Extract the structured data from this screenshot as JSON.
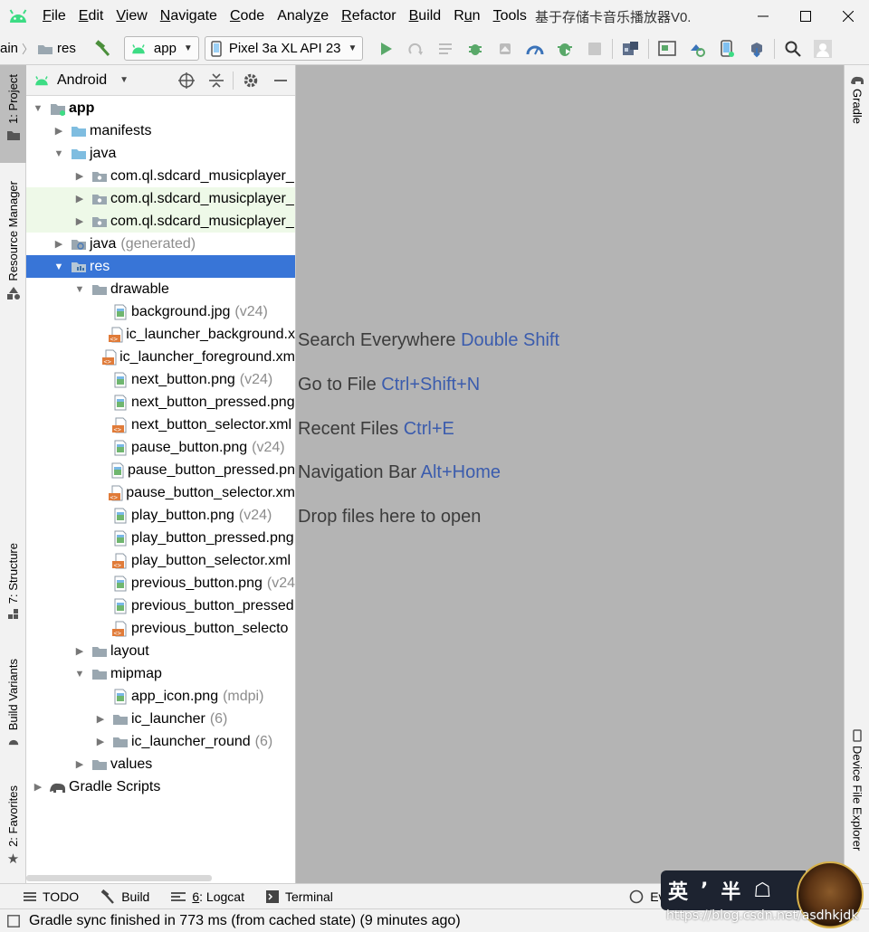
{
  "menubar": {
    "items": [
      {
        "pre": "",
        "u": "F",
        "post": "ile"
      },
      {
        "pre": "",
        "u": "E",
        "post": "dit"
      },
      {
        "pre": "",
        "u": "V",
        "post": "iew"
      },
      {
        "pre": "",
        "u": "N",
        "post": "avigate"
      },
      {
        "pre": "",
        "u": "C",
        "post": "ode"
      },
      {
        "pre": "Analy",
        "u": "z",
        "post": "e"
      },
      {
        "pre": "",
        "u": "R",
        "post": "efactor"
      },
      {
        "pre": "",
        "u": "B",
        "post": "uild"
      },
      {
        "pre": "R",
        "u": "u",
        "post": "n"
      },
      {
        "pre": "",
        "u": "T",
        "post": "ools"
      }
    ],
    "window_title": "基于存储卡音乐播放器V0.",
    "colors": {
      "android_green": "#3ddc84"
    }
  },
  "toolbar": {
    "crumb_prev": "ain",
    "crumb_current": "res",
    "run_config": "app",
    "device": "Pixel 3a XL API 23",
    "icons": [
      "hammer-icon",
      "run-icon",
      "apply-changes-icon",
      "sync-icon",
      "debug-icon",
      "attach-icon",
      "profile-icon",
      "coverage-icon",
      "stop-icon",
      "project-structure-icon",
      "avd-manager-icon",
      "sdk-manager-icon",
      "device-icon",
      "dependencies-icon",
      "search-icon",
      "user-icon"
    ]
  },
  "left_stripe": {
    "project_tab": "1: Project",
    "resource_tab": "Resource Manager",
    "structure_tab": "7: Structure",
    "build_variants_tab": "Build Variants",
    "favorites_tab": "2: Favorites"
  },
  "right_stripe": {
    "gradle_tab": "Gradle",
    "device_explorer_tab": "Device File Explorer"
  },
  "project_panel": {
    "view_mode": "Android",
    "tree": [
      {
        "depth": 0,
        "toggle": "open",
        "icon": "module",
        "label": "app",
        "bold": true
      },
      {
        "depth": 1,
        "toggle": "closed",
        "icon": "folder-blue",
        "label": "manifests"
      },
      {
        "depth": 1,
        "toggle": "open",
        "icon": "folder-blue",
        "label": "java"
      },
      {
        "depth": 2,
        "toggle": "closed",
        "icon": "package",
        "label": "com.ql.sdcard_musicplayer_"
      },
      {
        "depth": 2,
        "toggle": "closed",
        "icon": "package",
        "label": "com.ql.sdcard_musicplayer_",
        "hl": true
      },
      {
        "depth": 2,
        "toggle": "closed",
        "icon": "package",
        "label": "com.ql.sdcard_musicplayer_",
        "hl": true
      },
      {
        "depth": 1,
        "toggle": "closed",
        "icon": "folder-gen",
        "label": "java",
        "meta": "(generated)"
      },
      {
        "depth": 1,
        "toggle": "open",
        "icon": "folder-res",
        "label": "res",
        "selected": true
      },
      {
        "depth": 2,
        "toggle": "open",
        "icon": "folder-gray",
        "label": "drawable"
      },
      {
        "depth": 3,
        "toggle": "none",
        "icon": "image",
        "label": "background.jpg",
        "meta": "(v24)"
      },
      {
        "depth": 3,
        "toggle": "none",
        "icon": "xml",
        "label": "ic_launcher_background.x"
      },
      {
        "depth": 3,
        "toggle": "none",
        "icon": "xml",
        "label": "ic_launcher_foreground.xm"
      },
      {
        "depth": 3,
        "toggle": "none",
        "icon": "image",
        "label": "next_button.png",
        "meta": "(v24)"
      },
      {
        "depth": 3,
        "toggle": "none",
        "icon": "image",
        "label": "next_button_pressed.png"
      },
      {
        "depth": 3,
        "toggle": "none",
        "icon": "xml",
        "label": "next_button_selector.xml"
      },
      {
        "depth": 3,
        "toggle": "none",
        "icon": "image",
        "label": "pause_button.png",
        "meta": "(v24)"
      },
      {
        "depth": 3,
        "toggle": "none",
        "icon": "image",
        "label": "pause_button_pressed.pn"
      },
      {
        "depth": 3,
        "toggle": "none",
        "icon": "xml",
        "label": "pause_button_selector.xm"
      },
      {
        "depth": 3,
        "toggle": "none",
        "icon": "image",
        "label": "play_button.png",
        "meta": "(v24)"
      },
      {
        "depth": 3,
        "toggle": "none",
        "icon": "image",
        "label": "play_button_pressed.png"
      },
      {
        "depth": 3,
        "toggle": "none",
        "icon": "xml",
        "label": "play_button_selector.xml"
      },
      {
        "depth": 3,
        "toggle": "none",
        "icon": "image",
        "label": "previous_button.png",
        "meta": "(v24"
      },
      {
        "depth": 3,
        "toggle": "none",
        "icon": "image",
        "label": "previous_button_pressed"
      },
      {
        "depth": 3,
        "toggle": "none",
        "icon": "xml",
        "label": "previous_button_selecto"
      },
      {
        "depth": 2,
        "toggle": "closed",
        "icon": "folder-gray",
        "label": "layout"
      },
      {
        "depth": 2,
        "toggle": "open",
        "icon": "folder-gray",
        "label": "mipmap"
      },
      {
        "depth": 3,
        "toggle": "none",
        "icon": "image",
        "label": "app_icon.png",
        "meta": "(mdpi)"
      },
      {
        "depth": 3,
        "toggle": "closed",
        "icon": "folder-gray",
        "label": "ic_launcher",
        "meta": "(6)"
      },
      {
        "depth": 3,
        "toggle": "closed",
        "icon": "folder-gray",
        "label": "ic_launcher_round",
        "meta": "(6)"
      },
      {
        "depth": 2,
        "toggle": "closed",
        "icon": "folder-gray",
        "label": "values"
      },
      {
        "depth": 0,
        "toggle": "closed",
        "icon": "gradle",
        "label": "Gradle Scripts"
      }
    ]
  },
  "editor_hints": [
    {
      "text": "Search Everywhere",
      "key": "Double Shift"
    },
    {
      "text": "Go to File",
      "key": "Ctrl+Shift+N"
    },
    {
      "text": "Recent Files",
      "key": "Ctrl+E"
    },
    {
      "text": "Navigation Bar",
      "key": "Alt+Home"
    },
    {
      "text": "Drop files here to open",
      "key": ""
    }
  ],
  "bottom_tabs": {
    "todo": "TODO",
    "build": "Build",
    "logcat_num": "6",
    "logcat": ": Logcat",
    "terminal": "Terminal",
    "event_log": "Event"
  },
  "status": {
    "message": "Gradle sync finished in 773 ms (from cached state) (9 minutes ago)"
  },
  "watermark": {
    "chars": [
      "英",
      "ʼ",
      "半",
      "☖"
    ],
    "url": "https://blog.csdn.net/asdhkjdk"
  }
}
